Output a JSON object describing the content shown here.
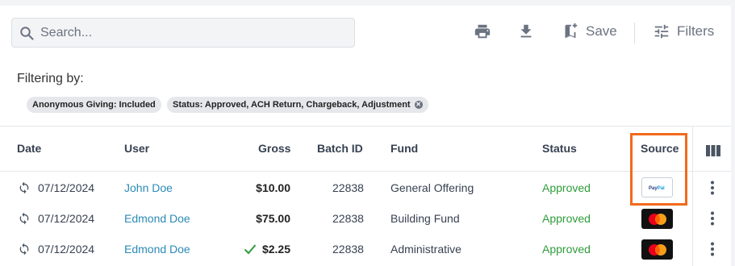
{
  "search": {
    "placeholder": "Search..."
  },
  "toolbar": {
    "save_label": "Save",
    "filters_label": "Filters"
  },
  "filters": {
    "heading": "Filtering by:",
    "chips": [
      {
        "label": "Anonymous Giving: Included"
      },
      {
        "label": "Status: Approved, ACH Return, Chargeback, Adjustment"
      }
    ]
  },
  "table": {
    "columns": [
      "Date",
      "User",
      "Gross",
      "Batch ID",
      "Fund",
      "Status",
      "Source"
    ],
    "rows": [
      {
        "date": "07/12/2024",
        "user": "John Doe",
        "gross": "$10.00",
        "batch_id": "22838",
        "fund": "General Offering",
        "status": "Approved",
        "source": "PayPal"
      },
      {
        "date": "07/12/2024",
        "user": "Edmond Doe",
        "gross": "$75.00",
        "batch_id": "22838",
        "fund": "Building Fund",
        "status": "Approved",
        "source": "Mastercard"
      },
      {
        "date": "07/12/2024",
        "user": "Edmond Doe",
        "gross": "$2.25",
        "batch_id": "22838",
        "fund": "Administrative",
        "status": "Approved",
        "source": "Mastercard"
      }
    ]
  },
  "colors": {
    "link": "#2b8ab5",
    "approved": "#2e9c3a",
    "highlight": "#f26a1b"
  }
}
